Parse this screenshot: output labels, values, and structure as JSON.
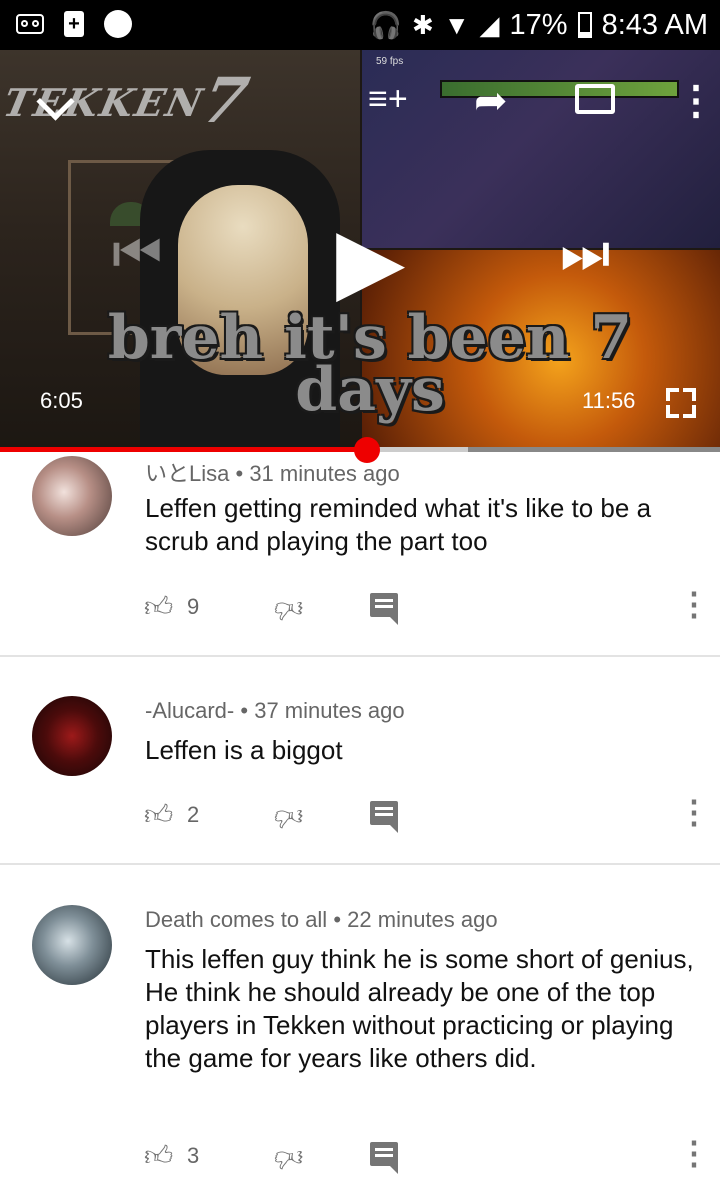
{
  "status_bar": {
    "battery_percent": "17%",
    "time": "8:43 AM",
    "icons": [
      "voicemail-icon",
      "battery-plus-icon",
      "notification-dot-icon",
      "headphones-icon",
      "bluetooth-icon",
      "wifi-icon",
      "signal-icon",
      "battery-icon"
    ]
  },
  "player": {
    "watermark_text": "TEKKEN",
    "watermark_number": "7",
    "fps_label": "59 fps",
    "caption_line1": "breh it's been 7",
    "caption_line2": "days",
    "current_time": "6:05",
    "duration": "11:56",
    "progress_fraction": 0.51,
    "buffer_fraction": 0.65,
    "controls": [
      "collapse-chevron-icon",
      "add-to-queue-icon",
      "share-icon",
      "cast-icon",
      "more-vert-icon",
      "previous-icon",
      "play-icon",
      "next-icon",
      "fullscreen-icon"
    ],
    "accent_color": "#ee0000"
  },
  "comments": [
    {
      "author": "いとLisa",
      "age": "31 minutes ago",
      "text": "Leffen getting reminded what it's like to be a scrub and playing the part too",
      "likes": "9"
    },
    {
      "author": "-Alucard-",
      "age": "37 minutes ago",
      "text": "Leffen is a biggot",
      "likes": "2"
    },
    {
      "author": "Death comes to all",
      "age": "22 minutes ago",
      "text": "This leffen guy think he is some short of genius, He think he should already be one of the top players in Tekken without practicing or playing the game for years like others did.",
      "likes": "3"
    }
  ],
  "separator": "•"
}
